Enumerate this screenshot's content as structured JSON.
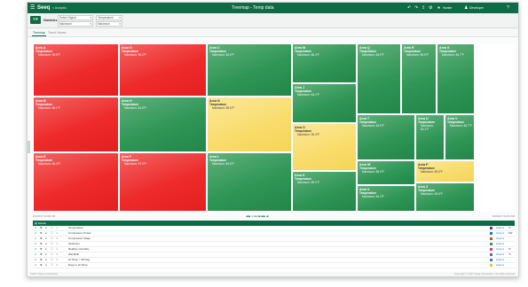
{
  "titlebar": {
    "app_name": "Seeq",
    "workbook": "< Analysis",
    "title": "Treemap - Temp data",
    "user": "Hunter",
    "admin": "Developer"
  },
  "toolbar": {
    "menu_label": "≡▾",
    "statistics_label": "Statistics",
    "selects": [
      {
        "value": "Select Signal"
      },
      {
        "value": "Temperature"
      },
      {
        "value": "Maximum"
      },
      {
        "value": "Maximum"
      }
    ]
  },
  "tabs": [
    {
      "label": "Treemap"
    },
    {
      "label": "Trend Viewer"
    }
  ],
  "treemap": {
    "cells": [
      {
        "name": "Area A",
        "param": "Temperature",
        "value": "Maximum: 94.8°F",
        "status": "red"
      },
      {
        "name": "Area G",
        "param": "Temperature",
        "value": "Maximum: 96.2°F",
        "status": "red"
      },
      {
        "name": "Area C",
        "param": "Temperature",
        "value": "Maximum: 84.5°F",
        "status": "green"
      },
      {
        "name": "Area M",
        "param": "Temperature",
        "value": "Maximum: 86.4°F",
        "status": "green"
      },
      {
        "name": "Area Q",
        "param": "Temperature",
        "value": "Maximum: 84.9°F",
        "status": "green"
      },
      {
        "name": "Area R",
        "param": "Temperature",
        "value": "Maximum: 85.5°F",
        "status": "green"
      },
      {
        "name": "Area S",
        "param": "Temperature",
        "value": "Maximum: 84.7°F",
        "status": "green"
      },
      {
        "name": "Area B",
        "param": "Temperature",
        "value": "Maximum: 98.1°F",
        "status": "red"
      },
      {
        "name": "Area H",
        "param": "Temperature",
        "value": "Maximum: 81.6°F",
        "status": "green"
      },
      {
        "name": "Area N",
        "param": "Temperature",
        "value": "Maximum: 89.6°F",
        "status": "yellow"
      },
      {
        "name": "Area J",
        "param": "Temperature",
        "value": "Maximum: 84.1°F",
        "status": "green"
      },
      {
        "name": "Area T",
        "param": "Temperature",
        "value": "Maximum: 83.9°F",
        "status": "green"
      },
      {
        "name": "Area U",
        "param": "Temperature",
        "value": "Maximum: 84.1°F",
        "status": "green"
      },
      {
        "name": "Area V",
        "param": "Temperature",
        "value": "Maximum: 83.7°F",
        "status": "green"
      },
      {
        "name": "Area O",
        "param": "Temperature",
        "value": "Maximum: 90.4°F",
        "status": "yellow"
      },
      {
        "name": "Area E",
        "param": "Temperature",
        "value": "Maximum: 96.3°F",
        "status": "red"
      },
      {
        "name": "Area F",
        "param": "Temperature",
        "value": "Maximum: 97.0°F",
        "status": "red"
      },
      {
        "name": "Area L",
        "param": "Temperature",
        "value": "Maximum: 84.6°F",
        "status": "green"
      },
      {
        "name": "Area K",
        "param": "Temperature",
        "value": "Maximum: 85.1°F",
        "status": "green"
      },
      {
        "name": "Area W",
        "param": "Temperature",
        "value": "Maximum: 85.0°F",
        "status": "green"
      },
      {
        "name": "Area P",
        "param": "Temperature",
        "value": "Maximum: 89.5°F",
        "status": "yellow"
      },
      {
        "name": "Area X",
        "param": "Temperature",
        "value": "Maximum: 84.4°F",
        "status": "green"
      },
      {
        "name": "Area Z",
        "param": "Temperature",
        "value": "Maximum: 83.6°F",
        "status": "green"
      }
    ]
  },
  "status_row": {
    "left": "6/1/2017 03:00 AM",
    "center": "◀ ▶ 1 day ▶ ▶▶ ◀",
    "right": "6/2/2017 03:00 AM"
  },
  "legend_bar": {
    "label": "Details"
  },
  "details_rows": [
    {
      "name": "Temperature",
      "swatch": "#7a2a8a",
      "area": "Area A",
      "units": "°F"
    },
    {
      "name": "Compressor Power",
      "swatch": "#1f6fb6",
      "area": "Area A",
      "units": "kW"
    },
    {
      "name": "Compressor Stage",
      "swatch": "#c25a1c",
      "area": "Area A",
      "units": ""
    },
    {
      "name": "Optimizer",
      "swatch": "#2f9656",
      "area": "Area A",
      "units": ""
    },
    {
      "name": "Relative Humidity",
      "swatch": "#d03a8c",
      "area": "Area A",
      "units": "%"
    },
    {
      "name": "Wet Bulb",
      "swatch": "#6b6b6b",
      "area": "Area A",
      "units": "°F"
    },
    {
      "name": "Hi Temp > 90 Deg",
      "swatch": "#3a7acc",
      "area": "Area A",
      "units": ""
    },
    {
      "name": "Days in Hi Temp",
      "swatch": "#e3c238",
      "area": "Area A",
      "units": ""
    }
  ],
  "footer": {
    "left": "©2017 Seeq Corporation",
    "right": "Copyright © 2017 Seeq Corporation. All rights reserved."
  },
  "colors": {
    "brand": "#0f6b46",
    "red": "#e31f1f",
    "green": "#2f9656",
    "yellow": "#f8dc6a"
  }
}
